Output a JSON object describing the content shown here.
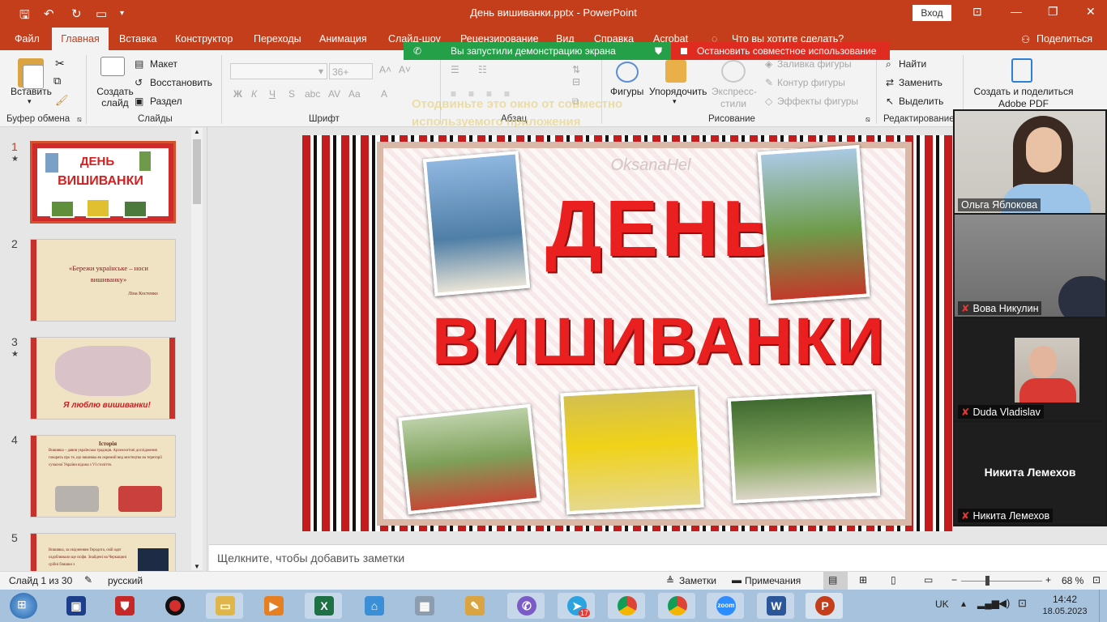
{
  "window": {
    "title": "День вишиванки.pptx  -  PowerPoint",
    "signin": "Вход"
  },
  "tabs": [
    "Файл",
    "Главная",
    "Вставка",
    "Конструктор",
    "Переходы",
    "Анимация",
    "Слайд-шоу",
    "Рецензирование",
    "Вид",
    "Справка",
    "Acrobat"
  ],
  "tellme": "Что вы хотите сделать?",
  "share_label": "Поделиться",
  "sharing": {
    "status": "Вы запустили демонстрацию экрана",
    "stop": "Остановить совместное использование"
  },
  "ghost_text": "Отодвиньте это окно от совместно используемого приложения",
  "ribbon": {
    "clipboard": {
      "paste": "Вставить",
      "group": "Буфер обмена"
    },
    "slides": {
      "new_slide": "Создать слайд",
      "layout": "Макет",
      "reset": "Восстановить",
      "section": "Раздел",
      "group": "Слайды"
    },
    "font": {
      "size": "36+",
      "group": "Шрифт"
    },
    "paragraph": {
      "group": "Абзац"
    },
    "drawing": {
      "shapes": "Фигуры",
      "arrange": "Упорядочить",
      "quick_styles": "Экспресс-стили",
      "fill": "Заливка фигуры",
      "outline": "Контур фигуры",
      "effects": "Эффекты фигуры",
      "group": "Рисование"
    },
    "editing": {
      "find": "Найти",
      "replace": "Заменить",
      "select": "Выделить",
      "group": "Редактирование"
    },
    "adobe": {
      "label": "Создать и поделиться Adobe PDF"
    }
  },
  "thumbnails": [
    {
      "num": "1",
      "star": "★"
    },
    {
      "num": "2",
      "quote": "«Бережи українське – носи вишиванку»",
      "author": "Ліна Костенко"
    },
    {
      "num": "3",
      "star": "★",
      "caption": "Я люблю вишиванки!"
    },
    {
      "num": "4",
      "title": "Історія",
      "body": "Вишивка – давня українська традиція. Археологічні дослідження говорять про те, що вишивка як окремий вид мистецтва на території сучасної України відома з VI століття."
    },
    {
      "num": "5",
      "body": "Вишивка, за свідченням Геродота, свій одяг оздоблювали ще скіфи. Знайдені на Черкащині срібні бляшки з"
    }
  ],
  "slide": {
    "line1": "ДЕНЬ",
    "line2": "ВИШИВАНКИ",
    "watermark": "OksanaHel"
  },
  "notes_placeholder": "Щелкните, чтобы добавить заметки",
  "status": {
    "slide": "Слайд 1 из 30",
    "lang": "русский",
    "notes": "Заметки",
    "comments": "Примечания",
    "zoom": "68 %"
  },
  "video": [
    {
      "name": "Ольга Яблокова",
      "muted": false
    },
    {
      "name": "Вова Никулин",
      "muted": true
    },
    {
      "name": "Duda Vladislav",
      "muted": true
    },
    {
      "name": "Никита Лемехов",
      "muted": true,
      "center": "Никита Лемехов"
    }
  ],
  "taskbar": {
    "lang": "UK",
    "time": "14:42",
    "date": "18.05.2023",
    "badge": "17"
  }
}
